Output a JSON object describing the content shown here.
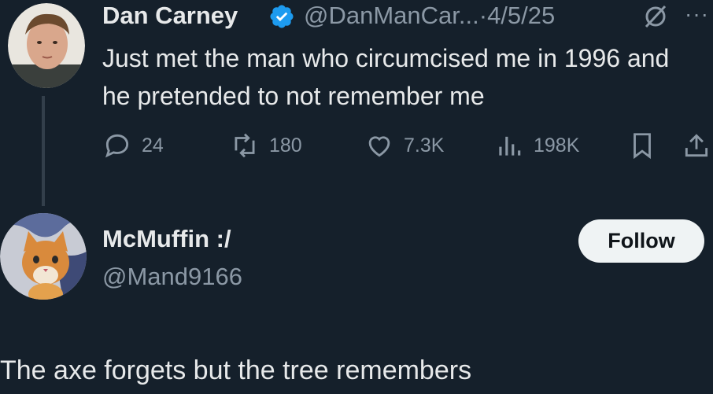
{
  "tweet": {
    "author_name": "Dan Carney",
    "author_handle": "@DanManCar...",
    "separator": "·",
    "date": "4/5/25",
    "text": "Just met the man who circumcised me in 1996 and he pretended to not remember me",
    "more_label": "···",
    "verified_icon": "verified-badge-icon",
    "stats": {
      "replies": "24",
      "reposts": "180",
      "likes": "7.3K",
      "views": "198K"
    }
  },
  "profile": {
    "name": "McMuffin :/",
    "handle": "@Mand9166",
    "follow_label": "Follow"
  },
  "reply": {
    "text": "The axe forgets but the tree remembers"
  },
  "colors": {
    "background": "#15202b",
    "text": "#e7e9ea",
    "muted": "#8b98a5",
    "verified": "#1d9bf0",
    "follow_bg": "#eff3f4"
  }
}
